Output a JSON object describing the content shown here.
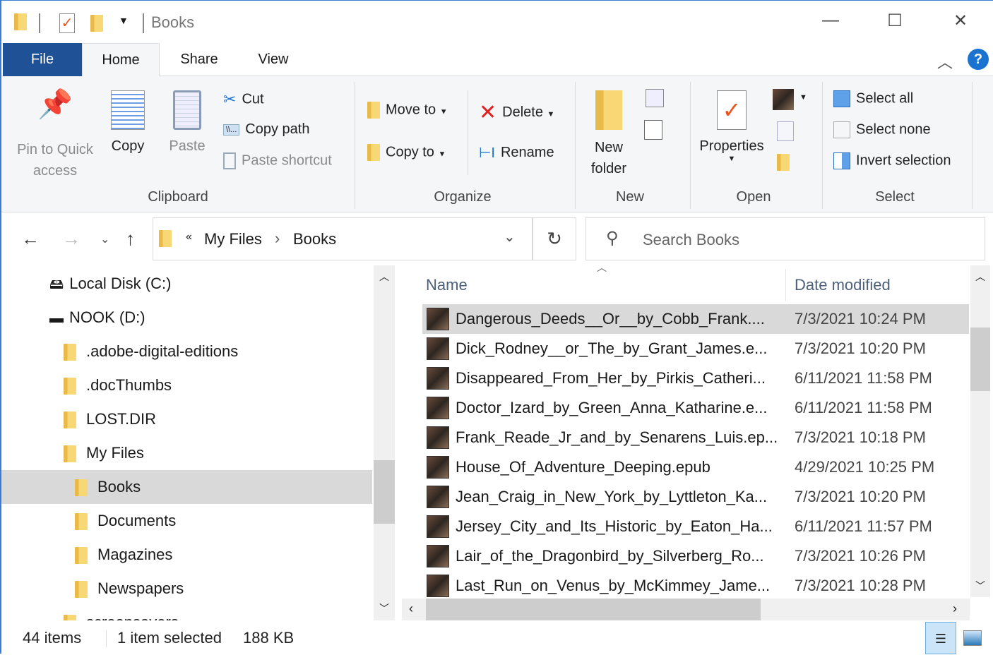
{
  "window": {
    "title": "Books",
    "minimize": "—",
    "maximize": "☐",
    "close": "✕"
  },
  "tabs": {
    "file": "File",
    "home": "Home",
    "share": "Share",
    "view": "View"
  },
  "ribbon": {
    "clipboard": {
      "pin": "Pin to Quick access",
      "pin1": "Pin to Quick",
      "pin2": "access",
      "copy": "Copy",
      "paste": "Paste",
      "cut": "Cut",
      "copy_path": "Copy path",
      "paste_shortcut": "Paste shortcut",
      "label": "Clipboard"
    },
    "organize": {
      "move_to": "Move to",
      "copy_to": "Copy to",
      "delete": "Delete",
      "rename": "Rename",
      "label": "Organize"
    },
    "new": {
      "new_folder1": "New",
      "new_folder2": "folder",
      "label": "New"
    },
    "open": {
      "properties": "Properties",
      "label": "Open"
    },
    "select": {
      "select_all": "Select all",
      "select_none": "Select none",
      "invert": "Invert selection",
      "label": "Select"
    }
  },
  "address": {
    "overflow": "«",
    "crumbs": [
      "My Files",
      "Books"
    ],
    "sep": "›"
  },
  "search": {
    "placeholder": "Search Books"
  },
  "nav": [
    {
      "label": "Local Disk (C:)",
      "type": "drive"
    },
    {
      "label": "NOOK (D:)",
      "type": "drive"
    },
    {
      "label": ".adobe-digital-editions",
      "type": "folder"
    },
    {
      "label": ".docThumbs",
      "type": "folder"
    },
    {
      "label": "LOST.DIR",
      "type": "folder"
    },
    {
      "label": "My Files",
      "type": "folder"
    },
    {
      "label": "Books",
      "type": "folder",
      "selected": true
    },
    {
      "label": "Documents",
      "type": "folder"
    },
    {
      "label": "Magazines",
      "type": "folder"
    },
    {
      "label": "Newspapers",
      "type": "folder"
    },
    {
      "label": "screensavers",
      "type": "folder"
    }
  ],
  "columns": {
    "name": "Name",
    "date": "Date modified"
  },
  "files": [
    {
      "name": "Dangerous_Deeds__Or__by_Cobb_Frank....",
      "date": "7/3/2021 10:24 PM",
      "selected": true
    },
    {
      "name": "Dick_Rodney__or_The_by_Grant_James.e...",
      "date": "7/3/2021 10:20 PM"
    },
    {
      "name": "Disappeared_From_Her_by_Pirkis_Catheri...",
      "date": "6/11/2021 11:58 PM"
    },
    {
      "name": "Doctor_Izard_by_Green_Anna_Katharine.e...",
      "date": "6/11/2021 11:58 PM"
    },
    {
      "name": "Frank_Reade_Jr_and_by_Senarens_Luis.ep...",
      "date": "7/3/2021 10:18 PM"
    },
    {
      "name": "House_Of_Adventure_Deeping.epub",
      "date": "4/29/2021 10:25 PM"
    },
    {
      "name": "Jean_Craig_in_New_York_by_Lyttleton_Ka...",
      "date": "7/3/2021 10:20 PM"
    },
    {
      "name": "Jersey_City_and_Its_Historic_by_Eaton_Ha...",
      "date": "6/11/2021 11:57 PM"
    },
    {
      "name": "Lair_of_the_Dragonbird_by_Silverberg_Ro...",
      "date": "7/3/2021 10:26 PM"
    },
    {
      "name": "Last_Run_on_Venus_by_McKimmey_Jame...",
      "date": "7/3/2021 10:28 PM"
    }
  ],
  "status": {
    "count": "44 items",
    "selected": "1 item selected",
    "size": "188 KB"
  }
}
